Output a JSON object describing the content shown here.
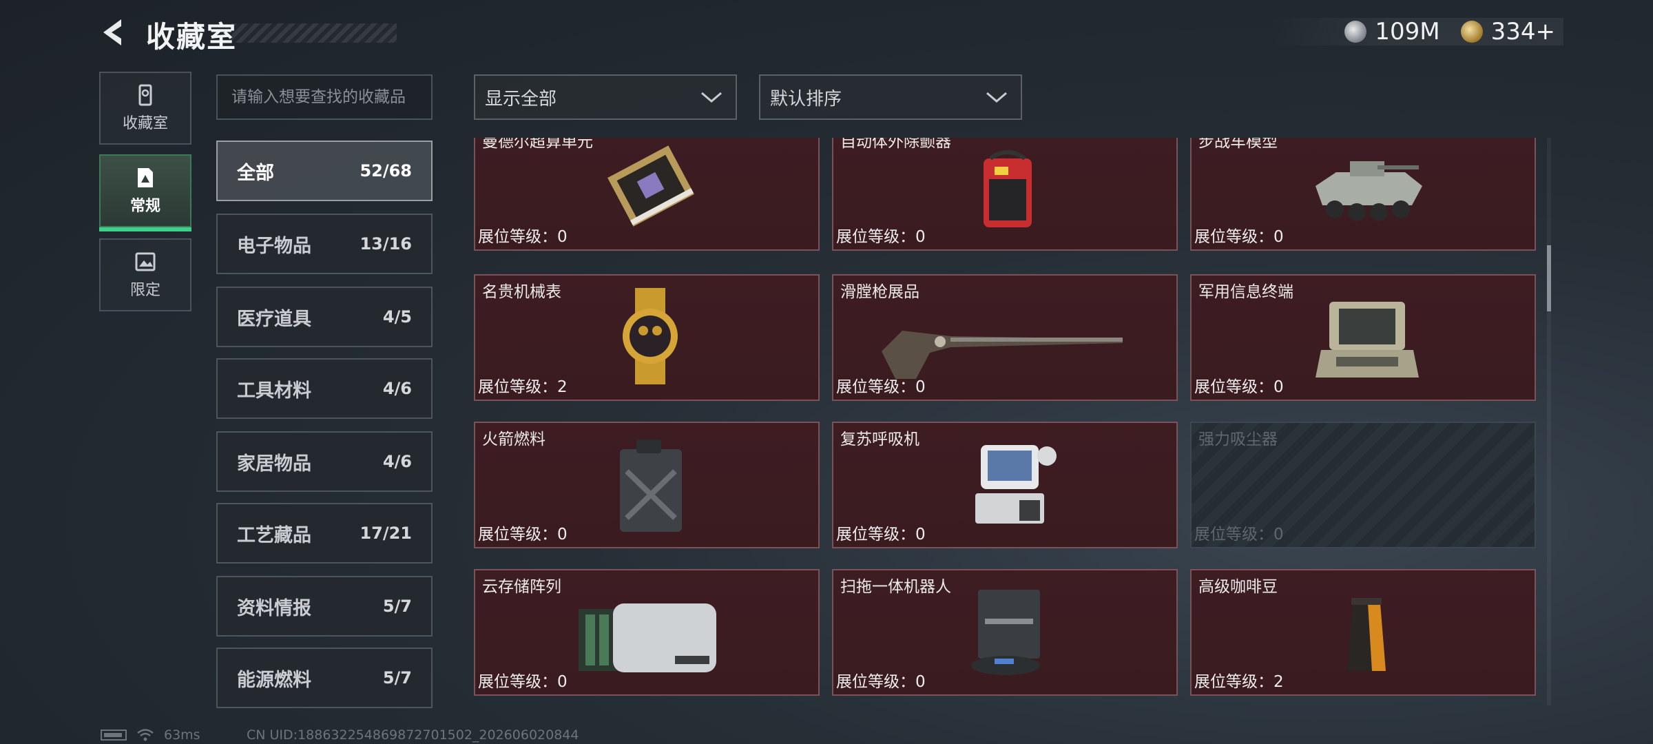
{
  "header": {
    "title": "收藏室",
    "currency": [
      {
        "icon": "silver-coin-icon",
        "value": "109M"
      },
      {
        "icon": "gold-coin-icon",
        "value": "334+"
      }
    ]
  },
  "left_tabs": [
    {
      "label": "收藏室",
      "icon": "collection-room-icon",
      "active": false
    },
    {
      "label": "常规",
      "icon": "regular-icon",
      "active": true
    },
    {
      "label": "限定",
      "icon": "limited-icon",
      "active": false
    }
  ],
  "search": {
    "placeholder": "请输入想要查找的收藏品"
  },
  "filters": {
    "display": "显示全部",
    "sort": "默认排序"
  },
  "categories": [
    {
      "name": "全部",
      "count": "52/68",
      "active": true
    },
    {
      "name": "电子物品",
      "count": "13/16"
    },
    {
      "name": "医疗道具",
      "count": "4/5"
    },
    {
      "name": "工具材料",
      "count": "4/6"
    },
    {
      "name": "家居物品",
      "count": "4/6"
    },
    {
      "name": "工艺藏品",
      "count": "17/21"
    },
    {
      "name": "资料情报",
      "count": "5/7"
    },
    {
      "name": "能源燃料",
      "count": "5/7"
    }
  ],
  "level_label": "展位等级：",
  "items": [
    {
      "name": "曼德尔超算单元",
      "level": "0",
      "icon": "supercomputer-unit-icon",
      "locked": false
    },
    {
      "name": "自动体外除颤器",
      "level": "0",
      "icon": "defibrillator-icon",
      "locked": false
    },
    {
      "name": "步战车模型",
      "level": "0",
      "icon": "armored-vehicle-model-icon",
      "locked": false
    },
    {
      "name": "名贵机械表",
      "level": "2",
      "icon": "mechanical-watch-icon",
      "locked": false
    },
    {
      "name": "滑膛枪展品",
      "level": "0",
      "icon": "musket-icon",
      "locked": false
    },
    {
      "name": "军用信息终端",
      "level": "0",
      "icon": "military-terminal-icon",
      "locked": false
    },
    {
      "name": "火箭燃料",
      "level": "0",
      "icon": "fuel-jerrycan-icon",
      "locked": false
    },
    {
      "name": "复苏呼吸机",
      "level": "0",
      "icon": "ventilator-icon",
      "locked": false
    },
    {
      "name": "强力吸尘器",
      "level": "0",
      "icon": "vacuum-cleaner-icon",
      "locked": true
    },
    {
      "name": "云存储阵列",
      "level": "0",
      "icon": "storage-array-icon",
      "locked": false
    },
    {
      "name": "扫拖一体机器人",
      "level": "0",
      "icon": "robot-vacuum-icon",
      "locked": false
    },
    {
      "name": "高级咖啡豆",
      "level": "2",
      "icon": "coffee-bag-icon",
      "locked": false
    }
  ],
  "footer": {
    "ping": "63ms",
    "uid": "CN UID:188632254869872701502_202606020844"
  }
}
